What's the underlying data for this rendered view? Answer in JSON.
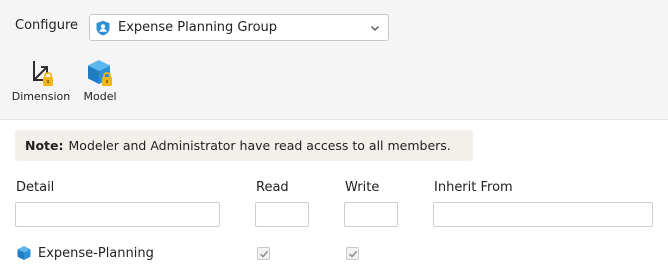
{
  "configure": {
    "label": "Configure",
    "selected": "Expense Planning Group"
  },
  "toolbar": {
    "dimension_label": "Dimension",
    "model_label": "Model"
  },
  "note": {
    "prefix": "Note:",
    "text": "Modeler and Administrator have read access to all members."
  },
  "columns": {
    "detail": "Detail",
    "read": "Read",
    "write": "Write",
    "inherit": "Inherit From"
  },
  "filters": {
    "detail": "",
    "read": "",
    "write": "",
    "inherit": ""
  },
  "rows": [
    {
      "name": "Expense-Planning",
      "read": true,
      "write": true,
      "icon": "cube-icon"
    }
  ],
  "colors": {
    "accent_blue": "#2f8fd6",
    "lock_gold": "#f2b51b",
    "note_bg": "#f3efea",
    "header_bg": "#f5f5f5"
  }
}
